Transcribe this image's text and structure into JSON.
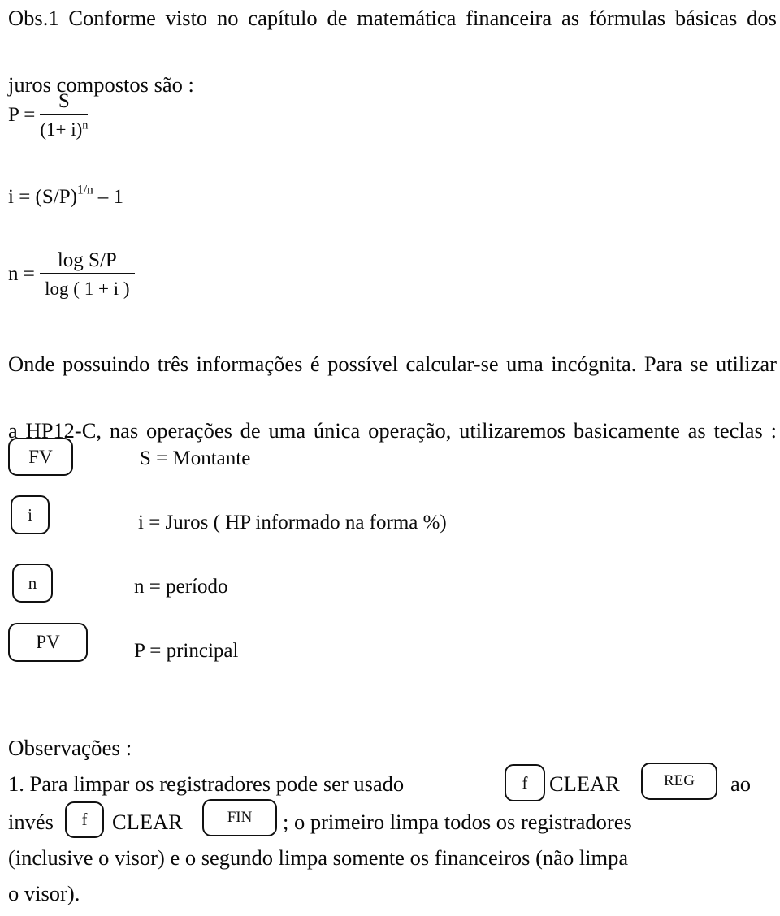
{
  "document": {
    "intro": {
      "line1": "Obs.1 Conforme visto no capítulo de matemática financeira as fórmulas básicas dos",
      "line2": "juros compostos são :"
    },
    "formulas": [
      {
        "id": "present-value",
        "lhs": "P =",
        "numerator": "S",
        "denominator_prefix": "(1+ i)",
        "denominator_exponent": "n"
      },
      {
        "id": "interest-rate",
        "expression_prefix": "i = (S/P)",
        "exponent": "1/n",
        "expression_suffix": "– 1"
      },
      {
        "id": "periods",
        "lhs": "n =",
        "numerator": "log S/P",
        "denominator": "log ( 1 + i )"
      }
    ],
    "mid_paragraph": {
      "line1": "Onde possuindo três informações é possível calcular-se uma incógnita. Para se utilizar",
      "line2": "a HP12-C, nas operações de uma única operação, utilizaremos basicamente as teclas :"
    },
    "keys": [
      {
        "key_label": "FV",
        "legend": "S = Montante"
      },
      {
        "key_label": "i",
        "legend": "i = Juros ( HP informado na forma %)"
      },
      {
        "key_label": "n",
        "legend": "n = período"
      },
      {
        "key_label": "PV",
        "legend": "P = principal"
      }
    ],
    "observations": {
      "title": "Observações :",
      "item1": {
        "part1": "1. Para limpar os registradores pode ser usado",
        "key_f_1": "f",
        "clear_1": "CLEAR",
        "key_reg": "REG",
        "part2": "ao",
        "part3": "invés",
        "key_f_2": "f",
        "clear_2": "CLEAR",
        "key_fin": "FIN",
        "part4": "; o primeiro limpa todos os registradores",
        "part5": "(inclusive o visor) e o segundo limpa somente os financeiros (não limpa",
        "part6": "o visor)."
      }
    }
  }
}
